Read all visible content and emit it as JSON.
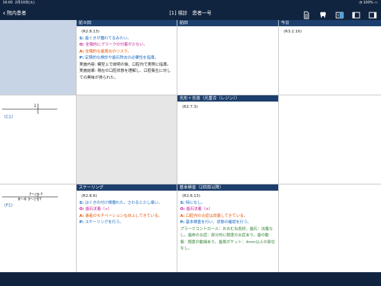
{
  "status": {
    "time": "16:00",
    "date": "2月10日(火)",
    "battery": "100%"
  },
  "nav": {
    "back_label": "院内患者",
    "title": "[1] 視診　患者一号"
  },
  "columns": {
    "c1": "前々回",
    "c2": "前回",
    "c3": "今日"
  },
  "row1": {
    "c1": {
      "date": "(R2.8.13)",
      "lines": [
        {
          "tag": "S:",
          "text": "歯ぐきが腫れてるみたい。",
          "cls": "S"
        },
        {
          "tag": "O:",
          "text": "全顎的にプラークの付着が少ない。",
          "cls": "O"
        },
        {
          "tag": "A:",
          "text": "全顎的な歯周炎のリスク。",
          "cls": "A"
        },
        {
          "tag": "P:",
          "text": "定期的な検診や歯石除去の必要性を指導。",
          "cls": "P"
        }
      ],
      "extra": [
        "実施内容: 模型上で説明の後、口腔内で実際に指導。",
        "実施結果: 現在の口腔状態を理解し、口腔衛生に対しての興味が得られた。"
      ]
    },
    "c3": {
      "date": "(R3.2.16)"
    }
  },
  "row2": {
    "tooth_label": "(C1)",
    "tooth_mark": "1",
    "c2_header": "充形＋充填（光重合（レジン））",
    "c2_date": "(R2.7.3)"
  },
  "row3": {
    "tooth_label": "(P1)",
    "tooth_top": "7〜|〜7",
    "tooth_bottom": "8〜6 3〜|〜7",
    "c1": {
      "header": "スケーリング",
      "date": "(R2.8.6)",
      "lines": [
        {
          "tag": "S:",
          "text": "はぐきの付け根腫れた。さわると少し痛い。",
          "cls": "S"
        },
        {
          "tag": "O:",
          "text": "歯石沈着（+）",
          "cls": "O"
        },
        {
          "tag": "A:",
          "text": "患者のモチベーションも向上してきている。",
          "cls": "A"
        },
        {
          "tag": "P:",
          "text": "スケーリングを行う。",
          "cls": "P"
        }
      ]
    },
    "c2": {
      "header": "基本検査（2回目以降）",
      "date": "(R2.8.13)",
      "lines": [
        {
          "tag": "S:",
          "text": "特になし。",
          "cls": "S"
        },
        {
          "tag": "O:",
          "text": "歯石沈着（±）",
          "cls": "O"
        },
        {
          "tag": "A:",
          "text": "口腔内の炎症は改善してきている。",
          "cls": "A"
        },
        {
          "tag": "P:",
          "text": "基本検査を行い、状態の確認を行う。",
          "cls": "P"
        }
      ],
      "extra": "プラークコントロール：おおむね良好。歯石：沈着なし。歯肉の炎症：部分的に軽度の炎症あり。歯の動揺：軽度の動揺あり。歯周ポケット：4mm以上の部位なし。"
    }
  }
}
